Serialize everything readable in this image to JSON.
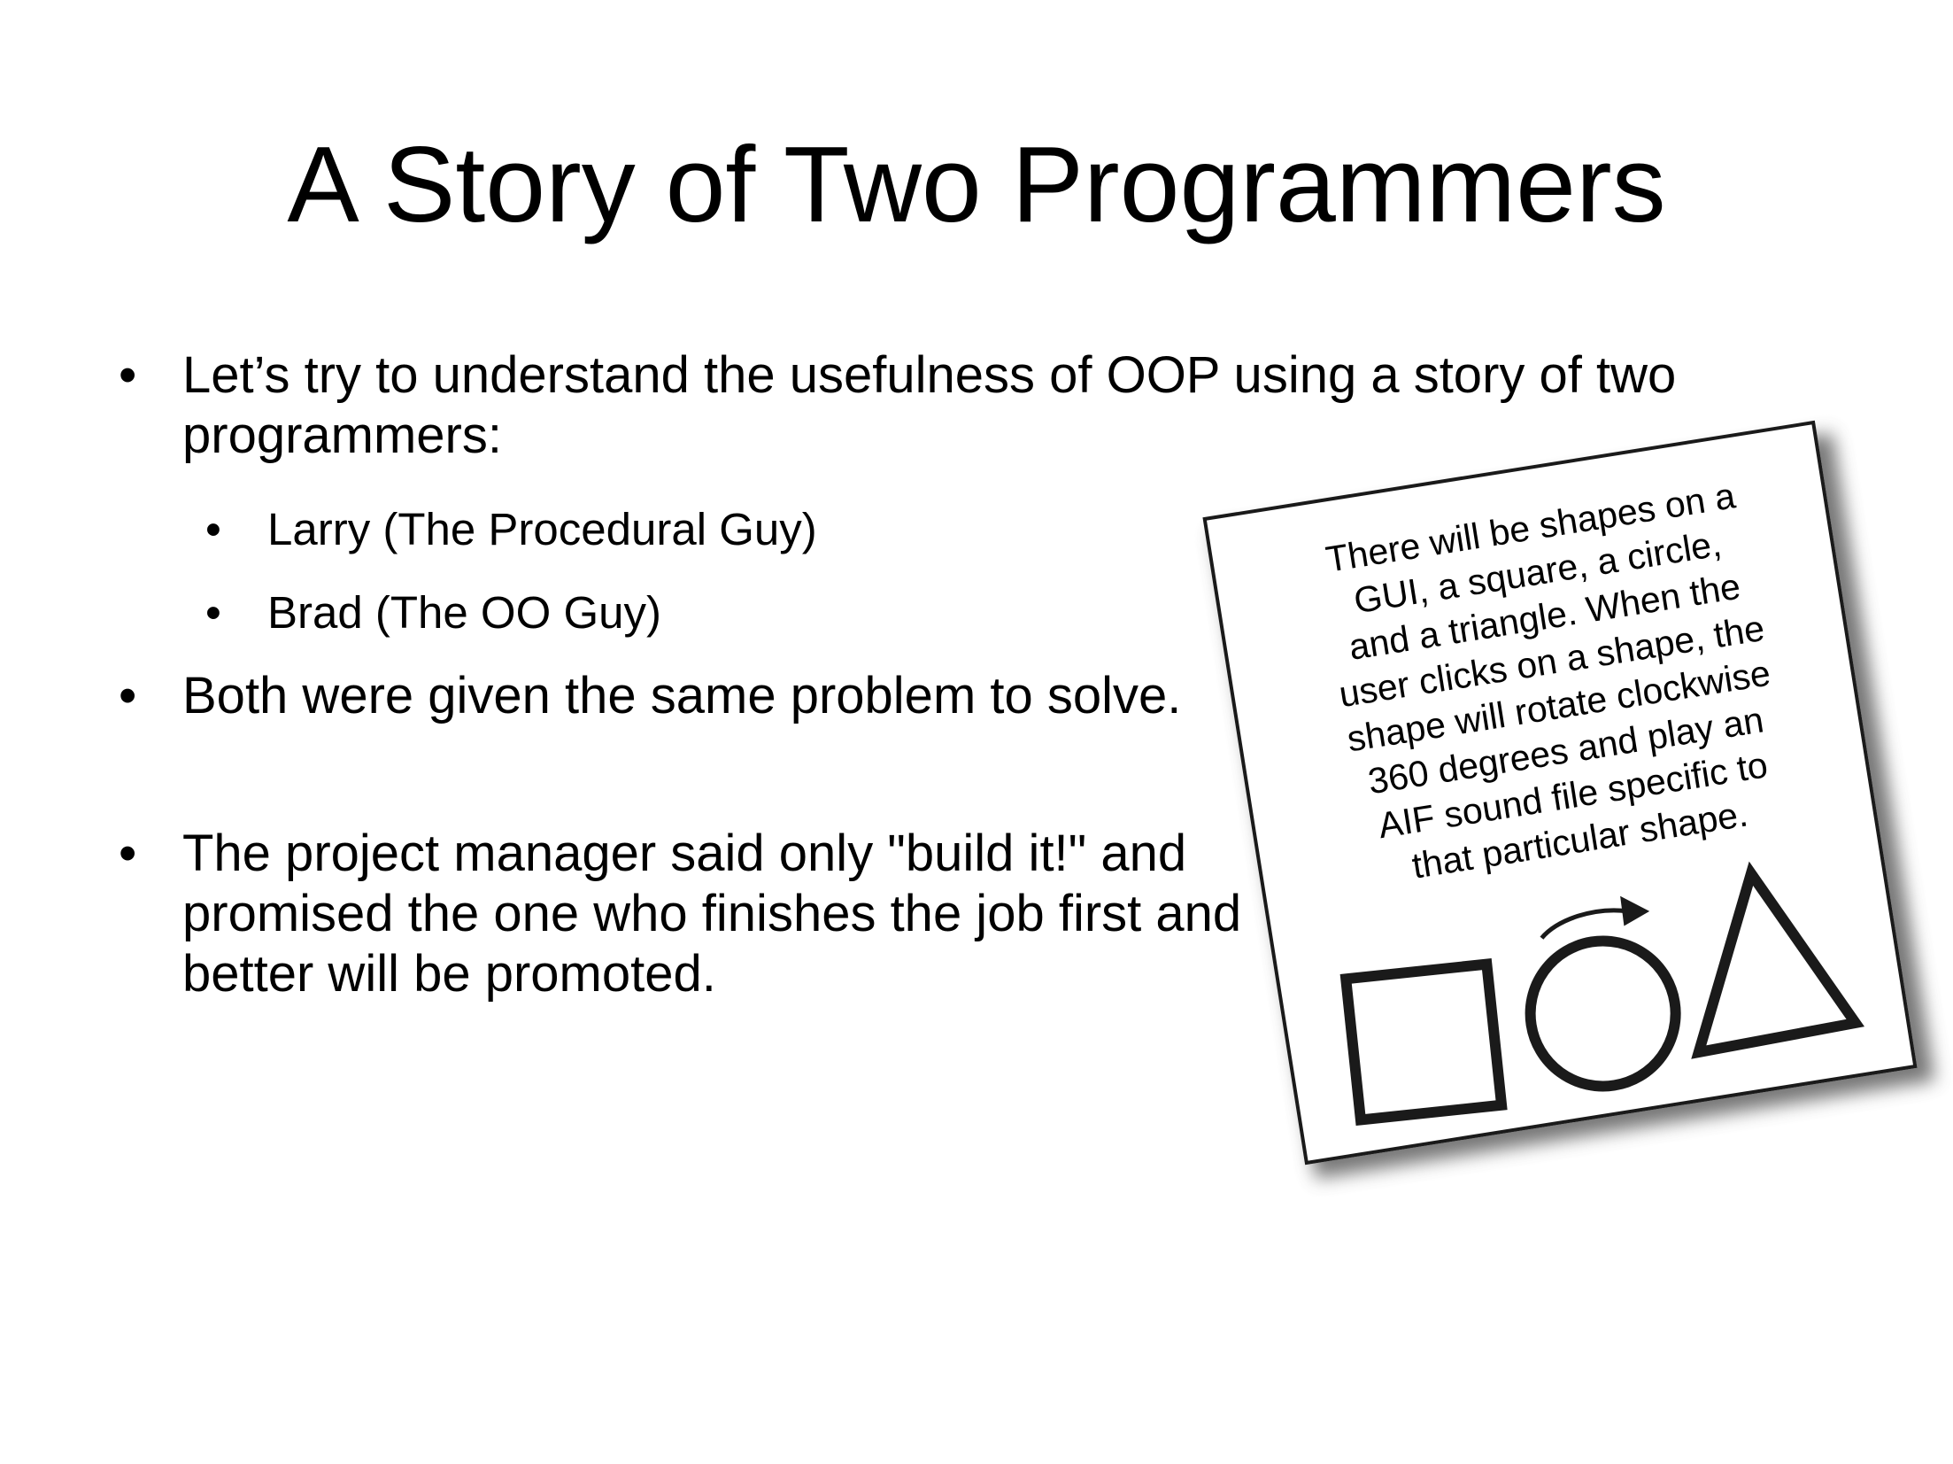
{
  "slide": {
    "title": "A Story of Two Programmers",
    "bullets": [
      {
        "marker": "•",
        "text": "Let’s try to understand the usefulness of OOP using a story of two programmers:"
      },
      {
        "marker": "•",
        "text": "Both were given the same problem to solve."
      },
      {
        "marker": "•",
        "text": "The project manager said only \"build it!\" and promised the one who finishes the job first and better will be promoted."
      }
    ],
    "sub_bullets": [
      {
        "marker": "•",
        "text": "Larry (The Procedural Guy)"
      },
      {
        "marker": "•",
        "text": "Brad (The OO Guy)"
      }
    ]
  },
  "spec_card": {
    "text": "There will be shapes on a\nGUI, a square, a circle,\nand a triangle. When the\nuser clicks on a shape, the\nshape will rotate clockwise\n360 degrees and play an\nAIF sound file specific to\nthat particular shape.",
    "shapes": [
      "square-icon",
      "circle-with-rotate-arrow-icon",
      "triangle-icon"
    ]
  },
  "colors": {
    "text": "#000000",
    "background": "#ffffff",
    "card_border": "#1a1a1a",
    "card_shadow": "#4a4a4a"
  }
}
